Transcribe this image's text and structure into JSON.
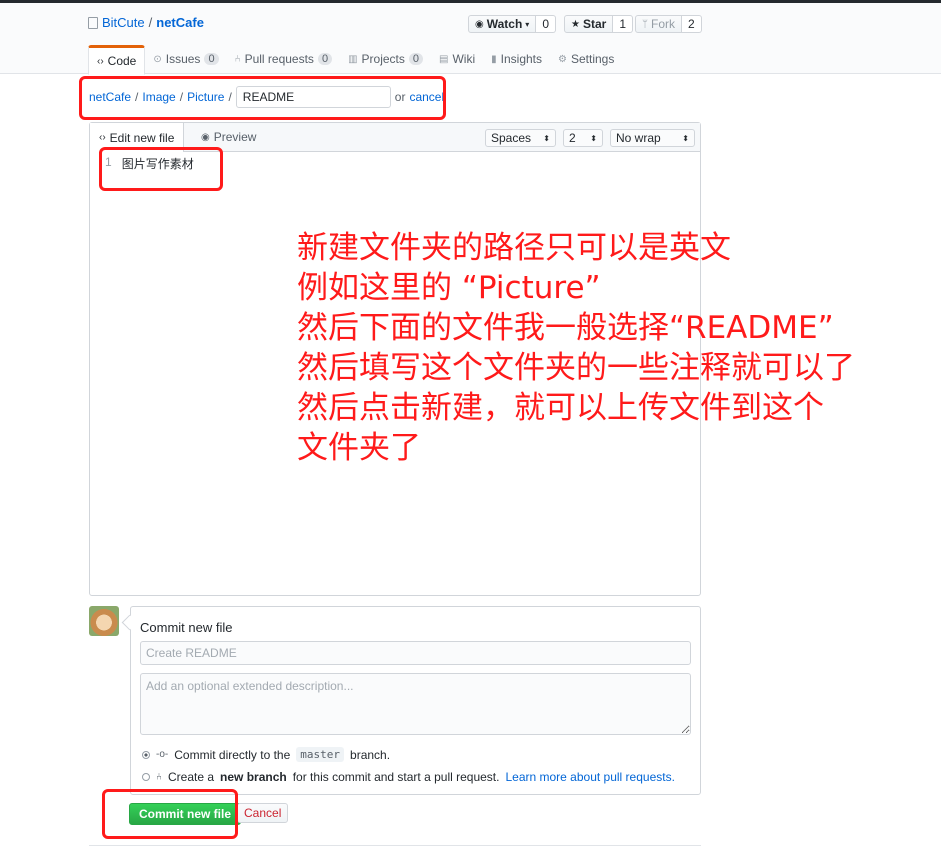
{
  "repo": {
    "owner": "BitCute",
    "separator": "/",
    "name": "netCafe"
  },
  "actions": [
    {
      "label": "Watch",
      "count": "0",
      "icon": "eye-icon"
    },
    {
      "label": "Star",
      "count": "1",
      "icon": "star-icon"
    },
    {
      "label": "Fork",
      "count": "2",
      "icon": "fork-icon"
    }
  ],
  "tabs": [
    {
      "label": "Code",
      "icon": "code-icon",
      "count": null
    },
    {
      "label": "Issues",
      "icon": "issue-icon",
      "count": "0"
    },
    {
      "label": "Pull requests",
      "icon": "pr-icon",
      "count": "0"
    },
    {
      "label": "Projects",
      "icon": "project-icon",
      "count": "0"
    },
    {
      "label": "Wiki",
      "icon": "book-icon",
      "count": null
    },
    {
      "label": "Insights",
      "icon": "graph-icon",
      "count": null
    },
    {
      "label": "Settings",
      "icon": "gear-icon",
      "count": null
    }
  ],
  "breadcrumb": {
    "parts": [
      "netCafe",
      "Image",
      "Picture"
    ],
    "sep": "/",
    "filename": "README",
    "or": "or",
    "cancel": "cancel"
  },
  "editor": {
    "tab_edit": "Edit new file",
    "tab_preview": "Preview",
    "indent_mode": "Spaces",
    "indent_size": "2",
    "wrap_mode": "No wrap",
    "line_number": "1",
    "content": "图片写作素材"
  },
  "annotation": "新建文件夹的路径只可以是英文\n例如这里的 “Picture”\n然后下面的文件我一般选择“README”\n然后填写这个文件夹的一些注释就可以了\n然后点击新建，就可以上传文件到这个\n文件夹了",
  "commit": {
    "title": "Commit new file",
    "summary_placeholder": "Create README",
    "desc_placeholder": "Add an optional extended description...",
    "opt1_pre": "Commit directly to the",
    "opt1_branch": "master",
    "opt1_post": "branch.",
    "opt2_pre": "Create a",
    "opt2_bold": "new branch",
    "opt2_post": "for this commit and start a pull request.",
    "opt2_link": "Learn more about pull requests.",
    "submit": "Commit new file",
    "cancel": "Cancel"
  },
  "colors": {
    "annotation_red": "#ff1a1a",
    "link_blue": "#0366d6",
    "commit_green": "#28a745",
    "tab_accent": "#e36209"
  }
}
